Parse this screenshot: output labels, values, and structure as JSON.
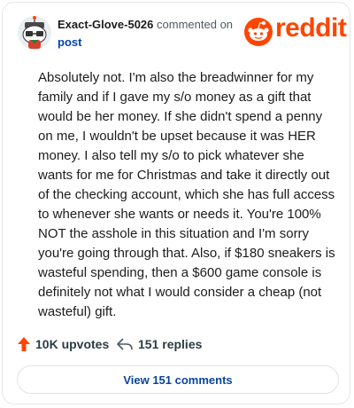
{
  "comment": {
    "author": "Exact-Glove-5026",
    "action_text": "commented on",
    "post_link_text": "post",
    "brand": "reddit",
    "body": "Absolutely not. I'm also the breadwinner for my family and if I gave my s/o money as a gift that would be her money. If she didn't spend a penny on me, I wouldn't be upset because it was HER money. I also tell my s/o to pick whatever she wants for me for Christmas and take it directly out of the checking account, which she has full access to whenever she wants or needs it. You're 100% NOT the asshole in this situation and I'm sorry you're going through that. Also, if $180 sneakers is wasteful spending, then a $600 game console is definitely not what I would consider a cheap (not wasteful) gift."
  },
  "stats": {
    "upvotes": "10K upvotes",
    "replies": "151 replies",
    "upvote_icon": "arrow-up-icon",
    "reply_icon": "reply-arrow-icon"
  },
  "actions": {
    "view_comments": "View 151 comments"
  },
  "colors": {
    "brand": "#ff4500",
    "link": "#0045ac",
    "text": "#1c1c1c"
  }
}
